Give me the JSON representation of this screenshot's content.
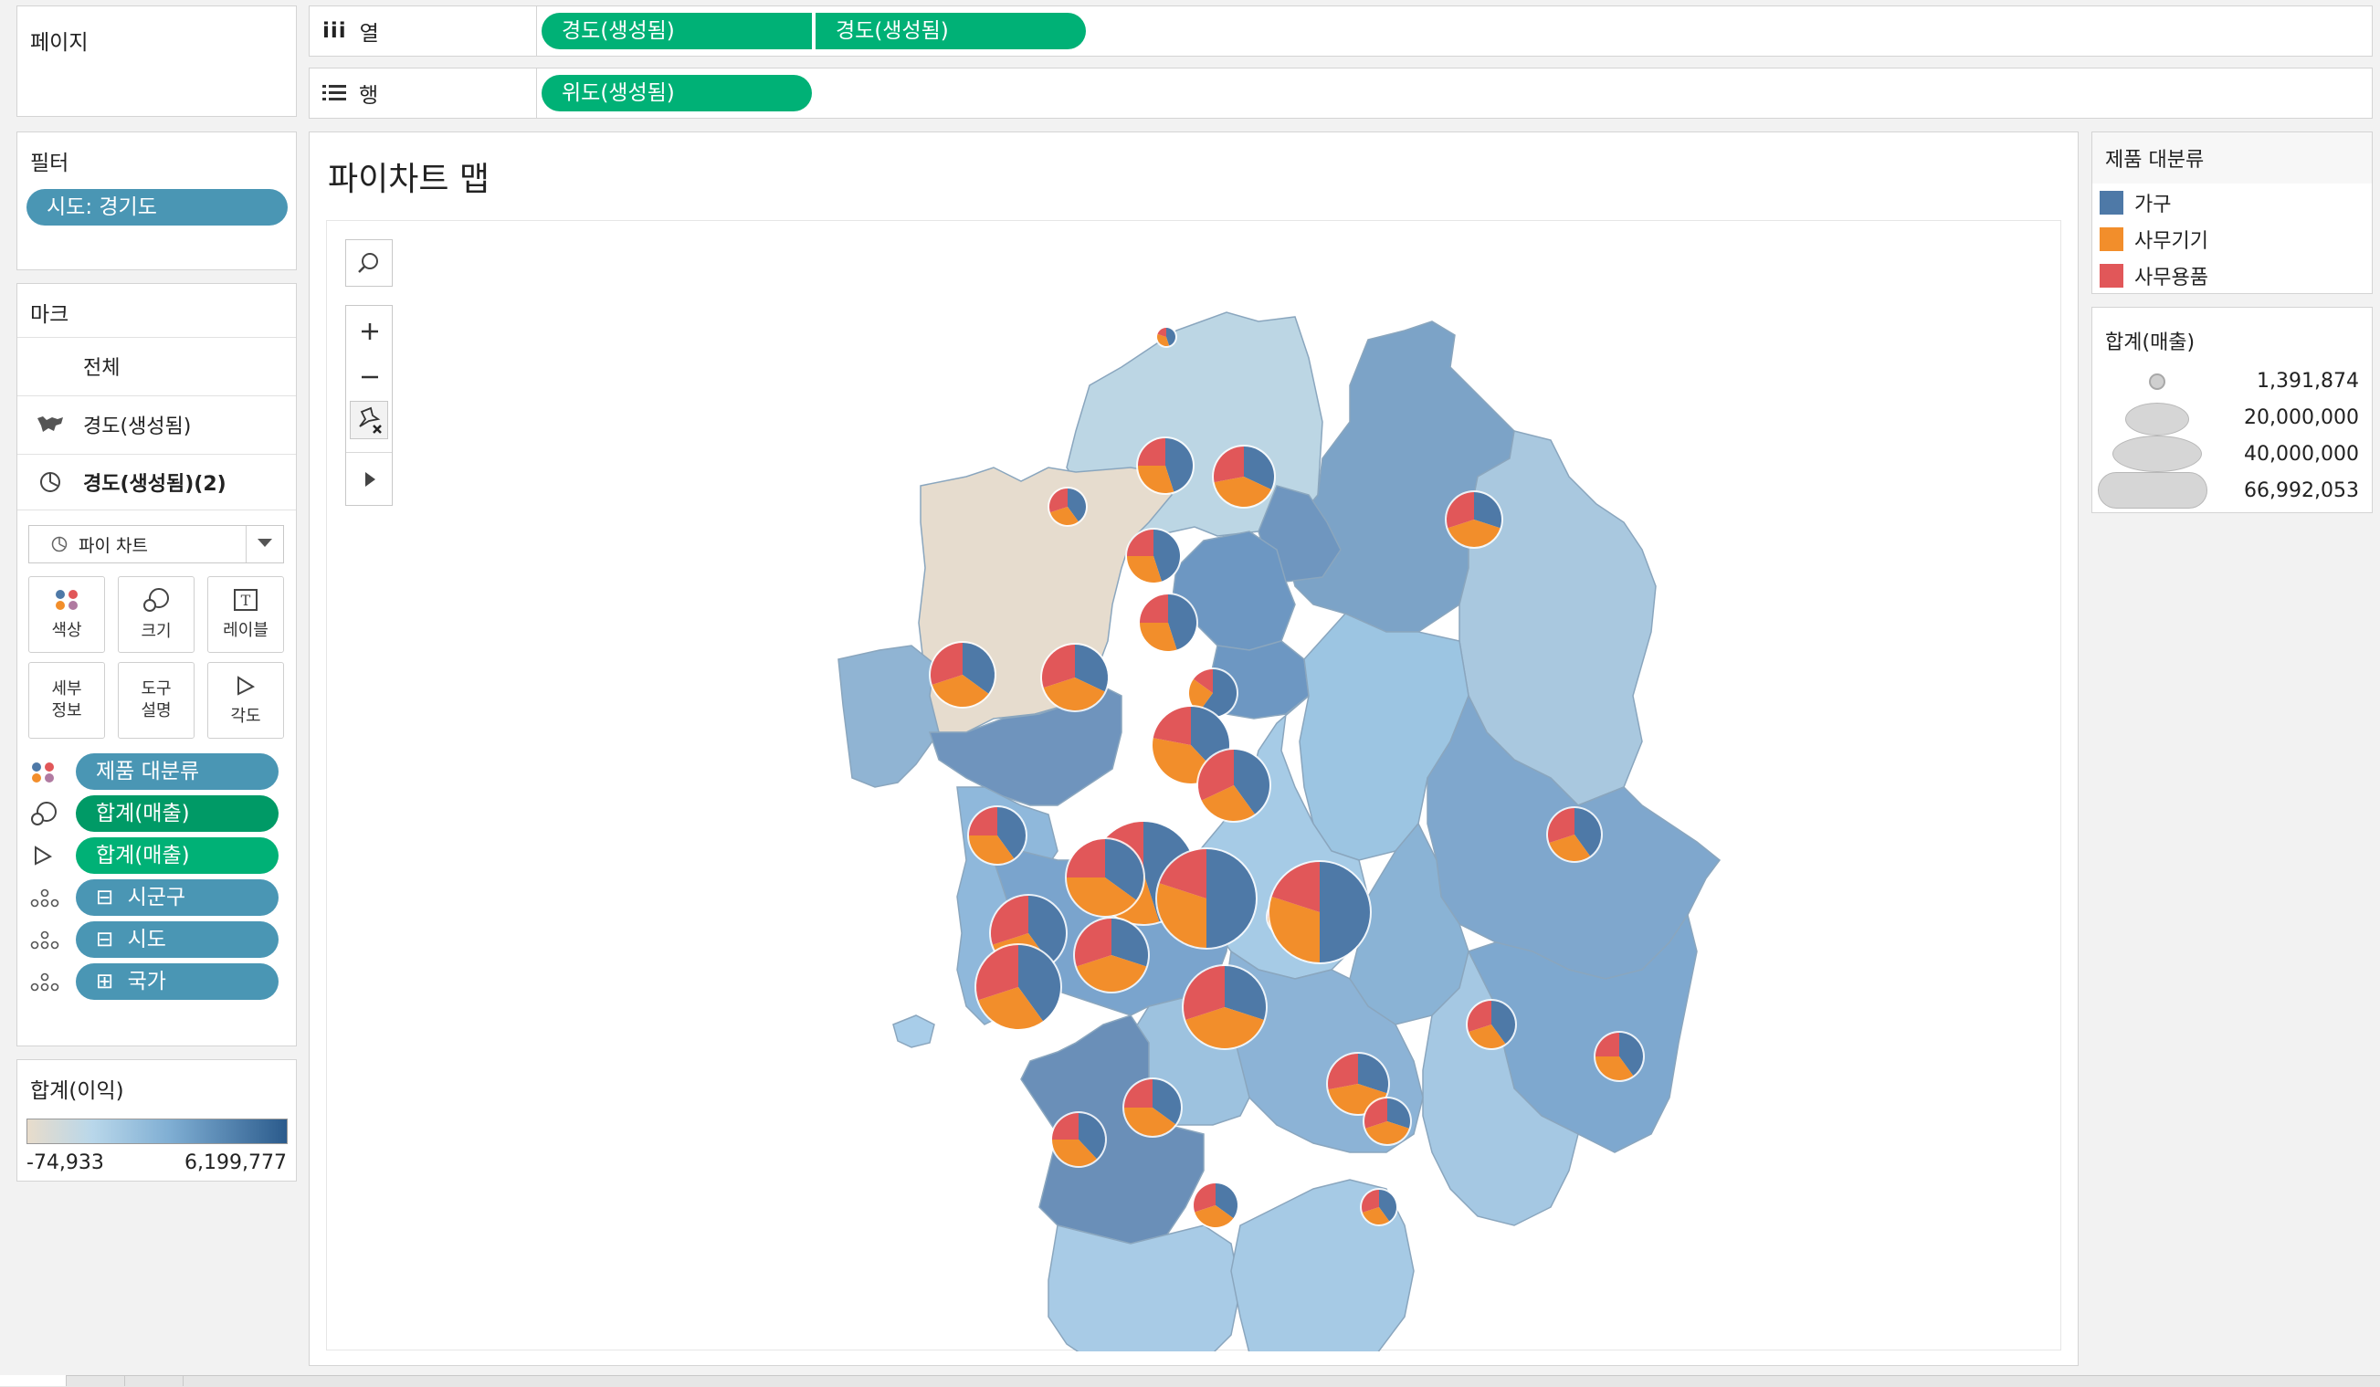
{
  "shelves": {
    "pages_label": "페이지",
    "columns_label": "열",
    "columns_pills": [
      "경도(생성됨)",
      "경도(생성됨)"
    ],
    "rows_label": "행",
    "rows_pills": [
      "위도(생성됨)"
    ]
  },
  "filters": {
    "title": "필터",
    "items": [
      "시도: 경기도"
    ]
  },
  "marks": {
    "title": "마크",
    "all_label": "전체",
    "layer1_label": "경도(생성됨)",
    "layer2_label": "경도(생성됨)(2)",
    "mark_type": "파이 차트",
    "cards": {
      "color": "색상",
      "size": "크기",
      "label": "레이블",
      "detail": "세부\n정보",
      "tooltip": "도구\n설명",
      "angle": "각도"
    },
    "fields": [
      {
        "label": "제품 대분류",
        "icon": "color-icon"
      },
      {
        "label": "합계(매출)",
        "icon": "size-icon"
      },
      {
        "label": "합계(매출)",
        "icon": "angle-icon"
      },
      {
        "label": "시군구",
        "icon": "detail-icon",
        "prefix": "⊟"
      },
      {
        "label": "시도",
        "icon": "detail-icon",
        "prefix": "⊟"
      },
      {
        "label": "국가",
        "icon": "detail-icon",
        "prefix": "⊞"
      }
    ]
  },
  "profit_legend": {
    "title": "합계(이익)",
    "min": "-74,933",
    "max": "6,199,777",
    "color_low": "#e8dccb",
    "color_mid": "#9ec9e2",
    "color_high": "#2b5b8c"
  },
  "view": {
    "title": "파이차트 맵"
  },
  "color_legend": {
    "title": "제품 대분류",
    "items": [
      {
        "label": "가구",
        "color": "#4e79a7"
      },
      {
        "label": "사무기기",
        "color": "#f28e2b"
      },
      {
        "label": "사무용품",
        "color": "#e15759"
      }
    ]
  },
  "size_legend": {
    "title": "합계(매출)",
    "items": [
      "1,391,874",
      "20,000,000",
      "40,000,000",
      "66,992,053"
    ]
  }
}
